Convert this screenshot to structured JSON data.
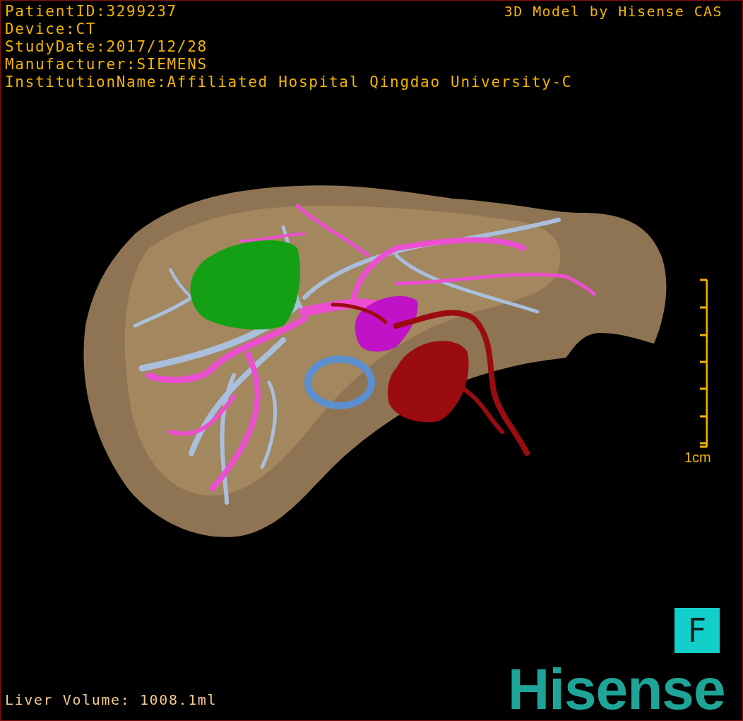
{
  "patient_info": [
    "PatientID:3299237",
    "Device:CT",
    "StudyDate:2017/12/28",
    "Manufacturer:SIEMENS",
    "InstitutionName:Affiliated Hospital Qingdao University-C"
  ],
  "model_credit": "3D Model by Hisense CAS",
  "scale_bar": {
    "label": "1cm"
  },
  "orientation_marker": "F",
  "liver_volume": "Liver Volume: 1008.1ml",
  "logo": "Hisense"
}
